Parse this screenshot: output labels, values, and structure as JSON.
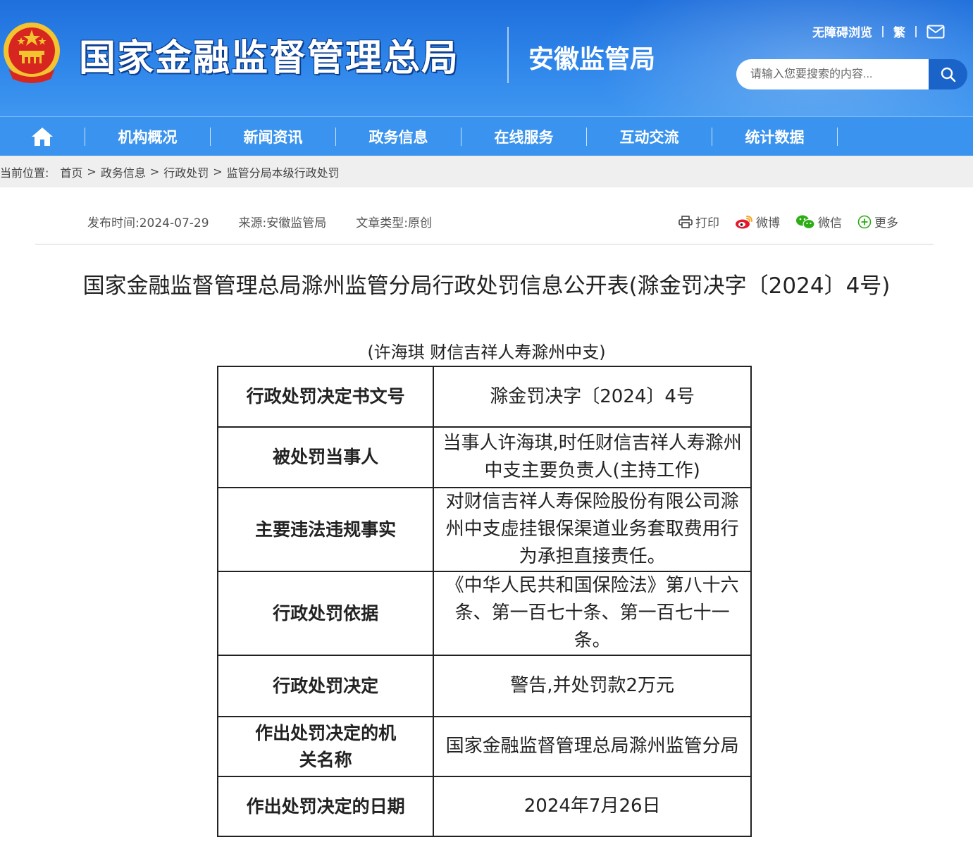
{
  "header": {
    "site_title": "国家金融监督管理总局",
    "branch_title": "安徽监管局",
    "accessibility_link": "无障碍浏览",
    "traditional_link": "繁",
    "search_placeholder": "请输入您要搜索的内容...",
    "colors": {
      "header_blue": "#2f86ea",
      "nav_blue": "#3a93ee",
      "emblem_red": "#d7261f",
      "emblem_gold": "#f4c430"
    }
  },
  "nav": {
    "items": [
      "机构概况",
      "新闻资讯",
      "政务信息",
      "在线服务",
      "互动交流",
      "统计数据"
    ]
  },
  "breadcrumb": {
    "label": "当前位置:",
    "path": [
      "首页",
      "政务信息",
      "行政处罚",
      "监管分局本级行政处罚"
    ],
    "separator": ">"
  },
  "meta": {
    "publish_time": "发布时间:2024-07-29",
    "source": "来源:安徽监管局",
    "article_type": "文章类型:原创"
  },
  "share": {
    "print": "打印",
    "weibo": "微博",
    "wechat": "微信",
    "more": "更多"
  },
  "article": {
    "title": "国家金融监督管理总局滁州监管分局行政处罚信息公开表(滁金罚决字〔2024〕4号)",
    "subtitle": "(许海琪 财信吉祥人寿滁州中支)",
    "rows": [
      {
        "label": "行政处罚决定书文号",
        "value": "滁金罚决字〔2024〕4号"
      },
      {
        "label": "被处罚当事人",
        "value": "当事人许海琪,时任财信吉祥人寿滁州中支主要负责人(主持工作)"
      },
      {
        "label": "主要违法违规事实",
        "value": "对财信吉祥人寿保险股份有限公司滁州中支虚挂银保渠道业务套取费用行为承担直接责任。"
      },
      {
        "label": "行政处罚依据",
        "value": "《中华人民共和国保险法》第八十六条、第一百七十条、第一百七十一条。"
      },
      {
        "label": "行政处罚决定",
        "value": "警告,并处罚款2万元"
      },
      {
        "label": "作出处罚决定的机关名称",
        "value": "国家金融监督管理总局滁州监管分局"
      },
      {
        "label": "作出处罚决定的日期",
        "value": "2024年7月26日"
      }
    ]
  }
}
